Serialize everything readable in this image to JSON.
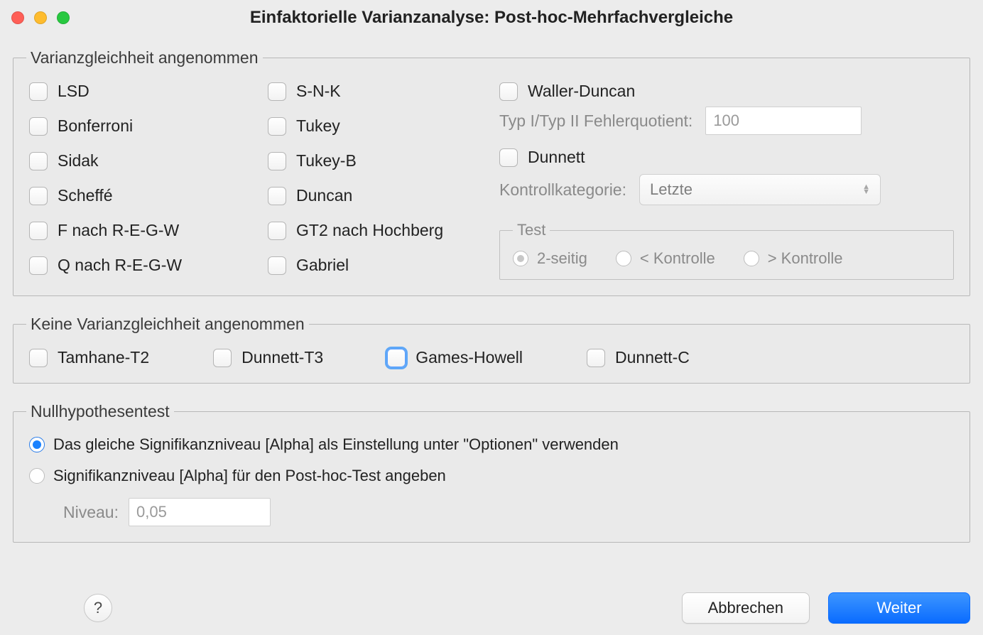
{
  "title": "Einfaktorielle Varianzanalyse: Post-hoc-Mehrfachvergleiche",
  "group1": {
    "legend": "Varianzgleichheit angenommen",
    "col1": [
      "LSD",
      "Bonferroni",
      "Sidak",
      "Scheffé",
      "F nach R-E-G-W",
      "Q nach R-E-G-W"
    ],
    "col2": [
      "S-N-K",
      "Tukey",
      "Tukey-B",
      "Duncan",
      "GT2 nach Hochberg",
      "Gabriel"
    ],
    "waller_duncan": "Waller-Duncan",
    "ratio_label": "Typ I/Typ II Fehlerquotient:",
    "ratio_value": "100",
    "dunnett": "Dunnett",
    "control_label": "Kontrollkategorie:",
    "control_value": "Letzte",
    "test_legend": "Test",
    "test_options": [
      "2-seitig",
      "< Kontrolle",
      "> Kontrolle"
    ],
    "test_selected": 0
  },
  "group2": {
    "legend": "Keine Varianzgleichheit angenommen",
    "options": [
      "Tamhane-T2",
      "Dunnett-T3",
      "Games-Howell",
      "Dunnett-C"
    ],
    "focused_index": 2
  },
  "group3": {
    "legend": "Nullhypothesentest",
    "opt1": "Das gleiche Signifikanzniveau [Alpha] als Einstellung unter \"Optionen\" verwenden",
    "opt2": "Signifikanzniveau [Alpha] für den Post-hoc-Test angeben",
    "selected": 0,
    "level_label": "Niveau:",
    "level_value": "0,05"
  },
  "footer": {
    "help": "?",
    "cancel": "Abbrechen",
    "continue": "Weiter"
  }
}
